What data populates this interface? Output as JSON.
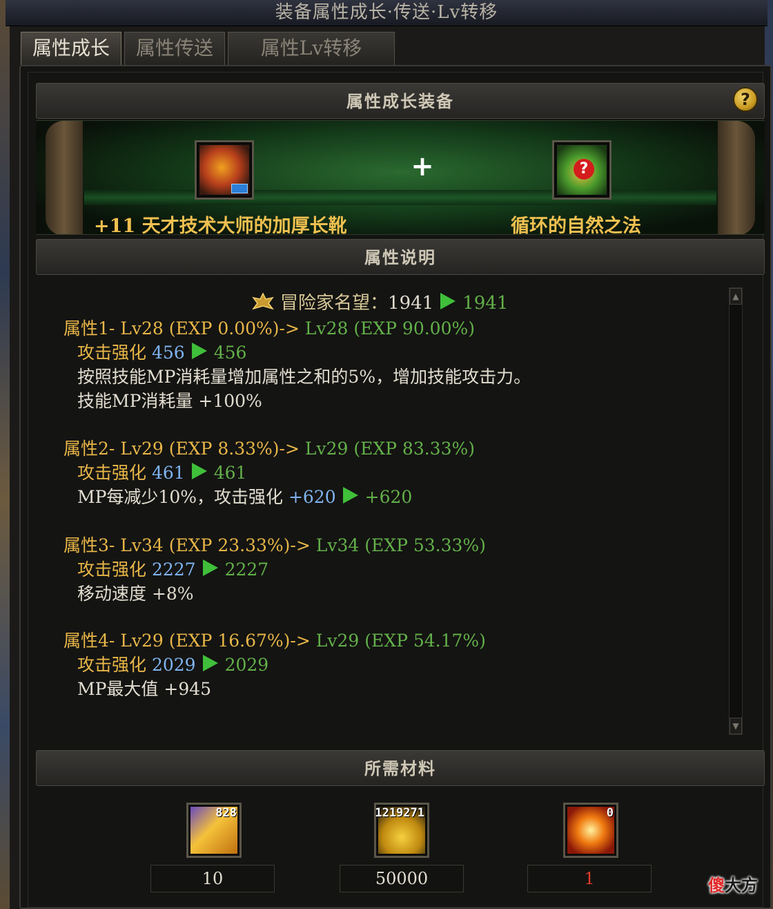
{
  "window_title": "装备属性成长·传送·Lv转移",
  "tabs": [
    {
      "label": "属性成长",
      "active": true
    },
    {
      "label": "属性传送",
      "active": false
    },
    {
      "label": "属性Lv转移",
      "active": false
    }
  ],
  "equip_section": {
    "header": "属性成长装备",
    "help_symbol": "?",
    "plus_symbol": "+",
    "left_item": {
      "name": "+11 天才技术大师的加厚长靴",
      "icon": "boots-icon"
    },
    "right_item": {
      "name": "循环的自然之法",
      "icon": "unknown-item-icon"
    }
  },
  "desc_section": {
    "header": "属性说明",
    "fame": {
      "label": "冒险家名望",
      "sep": "：",
      "from": "1941",
      "to": "1941"
    },
    "attributes": [
      {
        "title": "属性1- Lv28 (EXP 0.00%)->",
        "title_after": "Lv28 (EXP 90.00%)",
        "atk_label": "攻击强化",
        "atk_from": "456",
        "atk_to": "456",
        "lines": [
          "按照技能MP消耗量增加属性之和的5%，增加技能攻击力。",
          "技能MP消耗量 +100%"
        ]
      },
      {
        "title": "属性2- Lv29 (EXP 8.33%)->",
        "title_after": "Lv29 (EXP 83.33%)",
        "atk_label": "攻击强化",
        "atk_from": "461",
        "atk_to": "461",
        "extra": {
          "label": "MP每减少10%，攻击强化",
          "from": "+620",
          "to": "+620"
        }
      },
      {
        "title": "属性3- Lv34 (EXP 23.33%)->",
        "title_after": "Lv34 (EXP 53.33%)",
        "atk_label": "攻击强化",
        "atk_from": "2227",
        "atk_to": "2227",
        "lines": [
          "移动速度 +8%"
        ]
      },
      {
        "title": "属性4- Lv29 (EXP 16.67%)->",
        "title_after": "Lv29 (EXP 54.17%)",
        "atk_label": "攻击强化",
        "atk_from": "2029",
        "atk_to": "2029",
        "lines": [
          "MP最大值 +945"
        ]
      }
    ]
  },
  "materials_section": {
    "header": "所需材料",
    "items": [
      {
        "icon": "crystal-icon",
        "owned": "828",
        "required": "10",
        "color": "#e2ddd0"
      },
      {
        "icon": "gold-coins-icon",
        "owned": "1219271",
        "required": "50000",
        "color": "#e2ddd0"
      },
      {
        "icon": "sun-orb-icon",
        "owned": "0",
        "required": "1",
        "color": "#e23a2a"
      }
    ]
  },
  "watermark": {
    "part1": "傻",
    "part2": "大方"
  }
}
